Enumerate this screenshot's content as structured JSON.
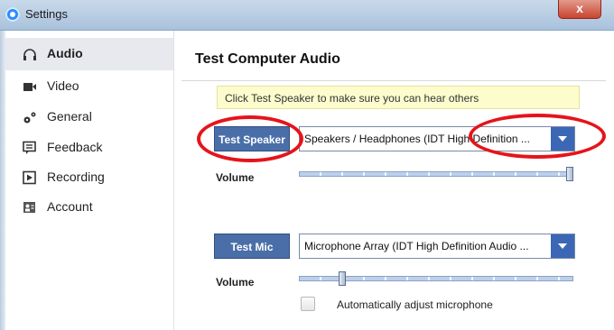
{
  "window": {
    "title": "Settings",
    "close_label": "x"
  },
  "sidebar": {
    "items": [
      {
        "label": "Audio",
        "icon": "headphones-icon",
        "active": true
      },
      {
        "label": "Video",
        "icon": "video-camera-icon",
        "active": false
      },
      {
        "label": "General",
        "icon": "gears-icon",
        "active": false
      },
      {
        "label": "Feedback",
        "icon": "feedback-icon",
        "active": false
      },
      {
        "label": "Recording",
        "icon": "play-icon",
        "active": false
      },
      {
        "label": "Account",
        "icon": "account-icon",
        "active": false
      }
    ]
  },
  "main": {
    "title": "Test Computer Audio",
    "hint": "Click Test Speaker to make sure you can hear others",
    "speaker": {
      "button_label": "Test Speaker",
      "device": "Speakers / Headphones (IDT High Definition ...",
      "volume_label": "Volume",
      "volume_level": 1.0
    },
    "mic": {
      "button_label": "Test Mic",
      "device": "Microphone Array (IDT High Definition Audio ...",
      "volume_label": "Volume",
      "volume_level": 0.15,
      "auto_adjust_label": "Automatically adjust microphone",
      "auto_adjust_checked": false
    }
  },
  "annotations": {
    "highlight_color": "#e5141a"
  },
  "colors": {
    "accent": "#4a6fa8",
    "dropdown_arrow": "#3c67b6",
    "hint_bg": "#fdfccd"
  }
}
